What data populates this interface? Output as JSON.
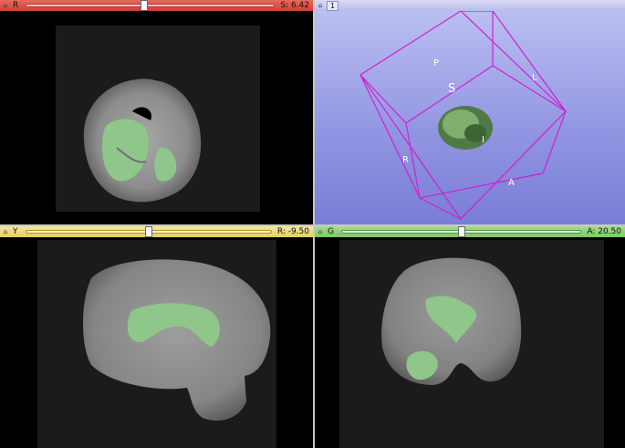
{
  "views": {
    "red": {
      "label": "R",
      "slider_fraction": 0.475,
      "readout": "S: 6.42",
      "color": "#d23f35"
    },
    "threed": {
      "label": "1",
      "color": "#b8bce8",
      "orientation_labels": {
        "p": "P",
        "s": "S",
        "l": "L",
        "r": "R",
        "i": "I",
        "a": "A"
      }
    },
    "yellow": {
      "label": "Y",
      "slider_fraction": 0.5,
      "readout": "R: -9.50",
      "color": "#e3cf5e"
    },
    "green": {
      "label": "G",
      "slider_fraction": 0.5,
      "readout": "A: 20.50",
      "color": "#7cc766"
    }
  },
  "icons": {
    "pin": "pin-icon"
  },
  "segmentation_color": "#8fc68a"
}
